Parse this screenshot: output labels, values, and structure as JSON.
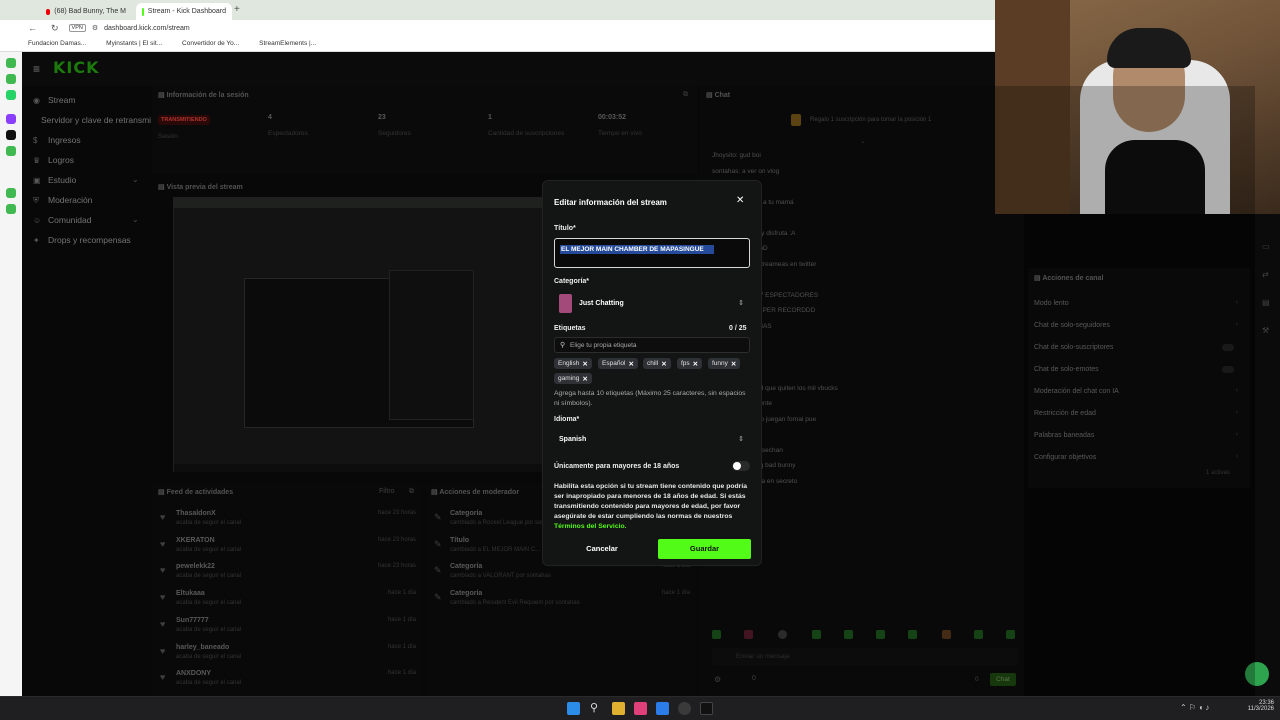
{
  "browser": {
    "tabs": [
      {
        "label": "(68) Bad Bunny, The M",
        "active": false
      },
      {
        "label": "Stream - Kick Dashboard",
        "active": true
      }
    ],
    "address": "dashboard.kick.com/stream",
    "vpn_label": "VPN",
    "bookmarks": [
      "Fundacion Damas...",
      "Myinstants | El sit...",
      "Convertidor de Yo...",
      "StreamElements |..."
    ]
  },
  "app": {
    "logo": "KICK"
  },
  "sidebar": {
    "items": [
      {
        "label": "Stream"
      },
      {
        "label": "Servidor y clave de retransmisión"
      },
      {
        "label": "Ingresos"
      },
      {
        "label": "Logros"
      },
      {
        "label": "Estudio"
      },
      {
        "label": "Moderación"
      },
      {
        "label": "Comunidad"
      },
      {
        "label": "Drops y recompensas"
      }
    ]
  },
  "session": {
    "title": "Información de la sesión",
    "status_badge": "TRANSMITIENDO",
    "status_sub": "Sesión",
    "stats": [
      {
        "value": "4",
        "label": "Espectadores"
      },
      {
        "value": "23",
        "label": "Seguidores"
      },
      {
        "value": "1",
        "label": "Cantidad de suscripciones"
      },
      {
        "value": "00:03:52",
        "label": "Tiempo en vivo"
      }
    ]
  },
  "preview": {
    "title": "Vista previa del stream"
  },
  "feed": {
    "title": "Feed de actividades",
    "filter_label": "Filtro",
    "items": [
      {
        "name": "ThasaldonX",
        "sub": "acaba de seguir el canal",
        "time": "hace 23 horas"
      },
      {
        "name": "XKERATON",
        "sub": "acaba de seguir el canal",
        "time": "hace 23 horas"
      },
      {
        "name": "pewelekk22",
        "sub": "acaba de seguir el canal",
        "time": "hace 23 horas"
      },
      {
        "name": "Eltukaaa",
        "sub": "acaba de seguir el canal",
        "time": "hace 1 día"
      },
      {
        "name": "Sun77777",
        "sub": "acaba de seguir el canal",
        "time": "hace 1 día"
      },
      {
        "name": "harley_baneado",
        "sub": "acaba de seguir el canal",
        "time": "hace 1 día"
      },
      {
        "name": "ANXDONY",
        "sub": "acaba de seguir el canal",
        "time": "hace 1 día"
      }
    ]
  },
  "mod_actions": {
    "title": "Acciones de moderador",
    "items": [
      {
        "name": "Categoría",
        "sub": "cambiado a Rocket League por sontahas",
        "time": "hace 1 día"
      },
      {
        "name": "Título",
        "sub": "cambiado a EL MEJOR MAIN C... por sontahas",
        "time": "hace 1 día"
      },
      {
        "name": "Categoría",
        "sub": "cambiado a VALORANT por sontahas",
        "time": "hace 1 día"
      },
      {
        "name": "Categoría",
        "sub": "cambiado a Resident Evil Requiem por sontahas",
        "time": "hace 1 día"
      }
    ]
  },
  "chat": {
    "title": "Chat",
    "pinned": "Regalo 1 suscripción para tomar la posición 1",
    "lines": [
      "Jhoysito: gud boi",
      "sontahas: a ver on vlog",
      "sontahas: nom",
      "sontahas: le digo a tu mamá",
      "sontahas: cyan",
      "sontahas: relaxy y disfruta :A",
      "sontahas: e woapD",
      "sontahas: paso streameas en twitter",
      "sontahas:",
      "sontahas: MIKE 7 ESPECTADORES",
      "sontahas: A ROMPER RECORDDD",
      "sontahas: AS 3 MAS",
      "sontahas: no",
      "sontahas: s 2",
      "sontahas: o bro",
      "sontahas: antes d que quiten los mil vbucks",
      "sontahas: cual gente",
      "sontahas: pero no juegan fornai pue",
      "sontahas: olam",
      "sontahas: pon hasechan",
      "sontahas: como q bad bunny",
      "sontahas: te gusta en secreto"
    ],
    "input_placeholder": "Enviar un mensaje",
    "viewer_count": "0",
    "send_label": "Chat"
  },
  "channel_actions": {
    "title": "Acciones de canal",
    "items": [
      "Modo lento",
      "Chat de solo-seguidores",
      "Chat de solo-suscriptores",
      "Chat de solo-emotes",
      "Moderación del chat con IA",
      "Restricción de edad",
      "Palabras baneadas",
      "Configurar objetivos"
    ],
    "objectives_hint": "1 activas"
  },
  "modal": {
    "title": "Editar información del stream",
    "title_label": "Título*",
    "title_value": "EL MEJOR MAIN CHAMBER DE MAPASINGUE",
    "category_label": "Categoría*",
    "category_value": "Just Chatting",
    "tags_label": "Etiquetas",
    "tags_count": "0 / 25",
    "tags_placeholder": "Elige tu propia etiqueta",
    "tags": [
      "English",
      "Español",
      "chill",
      "fps",
      "funny",
      "gaming"
    ],
    "tags_help": "Agrega hasta 10 etiquetas (Máximo 25 caracteres, sin espacios ni símbolos).",
    "language_label": "Idioma*",
    "language_value": "Spanish",
    "adult_label": "Únicamente para mayores de 18 años",
    "adult_help": "Habilita esta opción si tu stream tiene contenido que podría ser inapropiado para menores de 18 años de edad. Si estás transmitiendo contenido para mayores de edad, por favor asegúrate de estar cumpliendo las normas de nuestros",
    "adult_link": "Términos del Servicio.",
    "cancel_label": "Cancelar",
    "save_label": "Guardar"
  },
  "taskbar": {
    "time": "23:36",
    "date": "11/3/2026"
  },
  "colors": {
    "kick_green": "#53fc18",
    "badge_red": "#e8453c"
  }
}
